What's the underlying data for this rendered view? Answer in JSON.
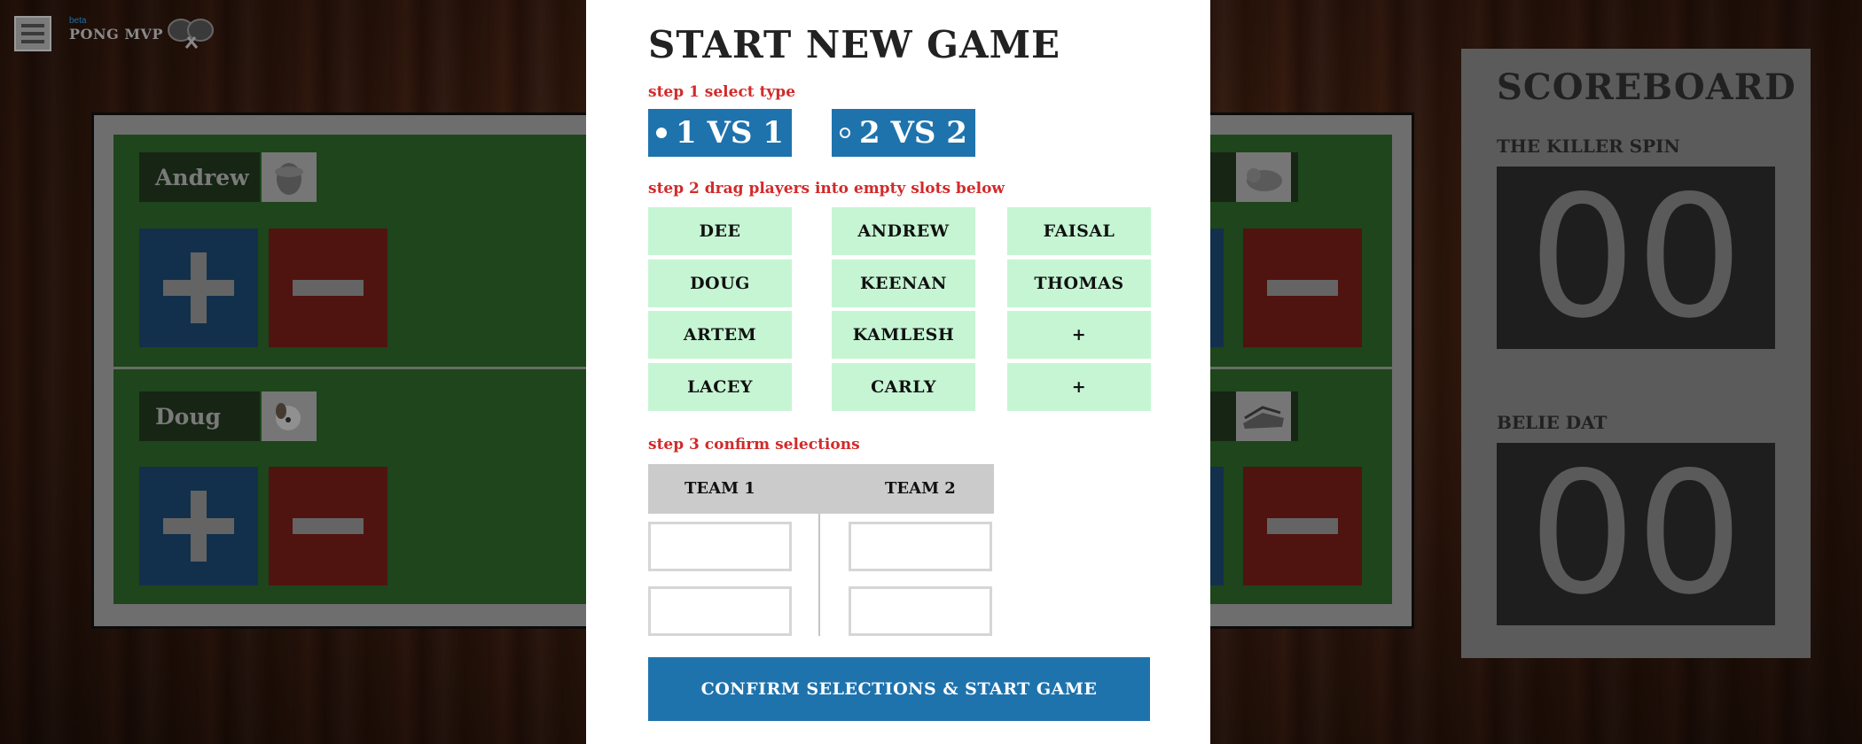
{
  "app": {
    "brand_small": "beta",
    "brand_name": "PONG MVP"
  },
  "board": {
    "left_players": [
      {
        "name": "Andrew",
        "avatar": "lorax-avatar"
      },
      {
        "name": "Doug",
        "avatar": "dog-avatar"
      }
    ],
    "right_players": [
      {
        "name": "",
        "avatar": "cat-avatar"
      },
      {
        "name": "",
        "avatar": "shoes-avatar"
      }
    ]
  },
  "scoreboard": {
    "title": "SCOREBOARD",
    "teams": [
      {
        "name": "THE KILLER SPIN",
        "score": "00"
      },
      {
        "name": "BELIE DAT",
        "score": "00"
      }
    ]
  },
  "modal": {
    "title": "START NEW GAME",
    "step1": "step 1 select type",
    "type_1v1": "1 VS 1",
    "type_2v2": "2 VS 2",
    "step2": "step 2 drag players into empty slots below",
    "players": [
      "DEE",
      "ANDREW",
      "FAISAL",
      "DOUG",
      "KEENAN",
      "THOMAS",
      "ARTEM",
      "KAMLESH",
      "+",
      "LACEY",
      "CARLY",
      "+"
    ],
    "step3": "step 3 confirm selections",
    "team1": "TEAM 1",
    "team2": "TEAM 2",
    "confirm": "CONFIRM SELECTIONS & START GAME"
  },
  "colors": {
    "accent": "#1f73ad",
    "step_label": "#d22a2a",
    "player_slot": "#c6f5d4",
    "court": "#2f6b2a"
  }
}
